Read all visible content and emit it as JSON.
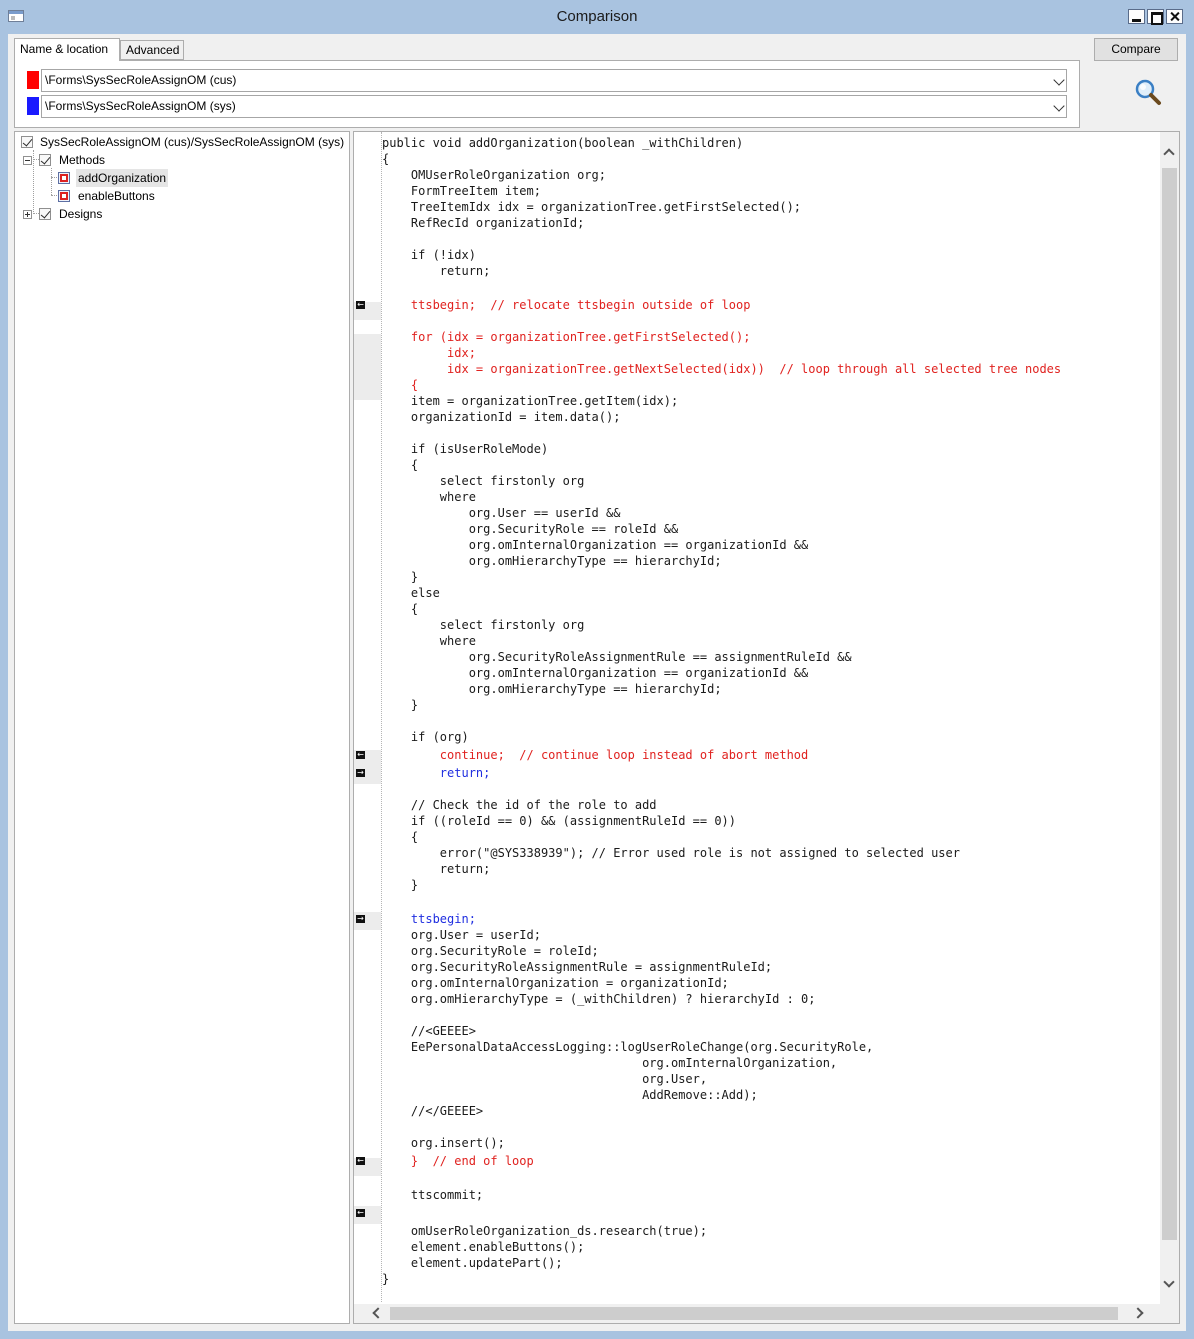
{
  "window": {
    "title": "Comparison"
  },
  "tabs": [
    {
      "label": "Name & location",
      "active": true
    },
    {
      "label": "Advanced",
      "active": false
    }
  ],
  "sources": [
    {
      "path": "\\Forms\\SysSecRoleAssignOM (cus)",
      "color": "#ff0000"
    },
    {
      "path": "\\Forms\\SysSecRoleAssignOM (sys)",
      "color": "#1a1aff"
    }
  ],
  "compare_button": {
    "label": "Compare"
  },
  "tree": {
    "root": "SysSecRoleAssignOM (cus)/SysSecRoleAssignOM (sys)",
    "methods_label": "Methods",
    "methods": [
      "addOrganization",
      "enableButtons"
    ],
    "designs_label": "Designs"
  },
  "code": {
    "lines": [
      {
        "text": "public void addOrganization(boolean _withChildren)",
        "style": "normal",
        "marker": "none"
      },
      {
        "text": "{",
        "style": "normal",
        "marker": "none"
      },
      {
        "text": "    OMUserRoleOrganization org;",
        "style": "normal",
        "marker": "none"
      },
      {
        "text": "    FormTreeItem item;",
        "style": "normal",
        "marker": "none"
      },
      {
        "text": "    TreeItemIdx idx = organizationTree.getFirstSelected();",
        "style": "normal",
        "marker": "none"
      },
      {
        "text": "    RefRecId organizationId;",
        "style": "normal",
        "marker": "none"
      },
      {
        "text": "",
        "style": "normal",
        "marker": "none"
      },
      {
        "text": "    if (!idx)",
        "style": "normal",
        "marker": "none"
      },
      {
        "text": "        return;",
        "style": "normal",
        "marker": "none"
      },
      {
        "text": "",
        "style": "normal",
        "marker": "none"
      },
      {
        "text": "    ttsbegin;  // relocate ttsbegin outside of loop",
        "style": "red",
        "marker": "left"
      },
      {
        "text": "",
        "style": "normal",
        "marker": "none"
      },
      {
        "text": "    for (idx = organizationTree.getFirstSelected();",
        "style": "red",
        "marker": "none"
      },
      {
        "text": "         idx;",
        "style": "red",
        "marker": "none"
      },
      {
        "text": "         idx = organizationTree.getNextSelected(idx))  // loop through all selected tree nodes",
        "style": "red",
        "marker": "none"
      },
      {
        "text": "    {",
        "style": "red",
        "marker": "none"
      },
      {
        "text": "    item = organizationTree.getItem(idx);",
        "style": "normal",
        "marker": "none"
      },
      {
        "text": "    organizationId = item.data();",
        "style": "normal",
        "marker": "none"
      },
      {
        "text": "",
        "style": "normal",
        "marker": "none"
      },
      {
        "text": "    if (isUserRoleMode)",
        "style": "normal",
        "marker": "none"
      },
      {
        "text": "    {",
        "style": "normal",
        "marker": "none"
      },
      {
        "text": "        select firstonly org",
        "style": "normal",
        "marker": "none"
      },
      {
        "text": "        where",
        "style": "normal",
        "marker": "none"
      },
      {
        "text": "            org.User == userId &&",
        "style": "normal",
        "marker": "none"
      },
      {
        "text": "            org.SecurityRole == roleId &&",
        "style": "normal",
        "marker": "none"
      },
      {
        "text": "            org.omInternalOrganization == organizationId &&",
        "style": "normal",
        "marker": "none"
      },
      {
        "text": "            org.omHierarchyType == hierarchyId;",
        "style": "normal",
        "marker": "none"
      },
      {
        "text": "    }",
        "style": "normal",
        "marker": "none"
      },
      {
        "text": "    else",
        "style": "normal",
        "marker": "none"
      },
      {
        "text": "    {",
        "style": "normal",
        "marker": "none"
      },
      {
        "text": "        select firstonly org",
        "style": "normal",
        "marker": "none"
      },
      {
        "text": "        where",
        "style": "normal",
        "marker": "none"
      },
      {
        "text": "            org.SecurityRoleAssignmentRule == assignmentRuleId &&",
        "style": "normal",
        "marker": "none"
      },
      {
        "text": "            org.omInternalOrganization == organizationId &&",
        "style": "normal",
        "marker": "none"
      },
      {
        "text": "            org.omHierarchyType == hierarchyId;",
        "style": "normal",
        "marker": "none"
      },
      {
        "text": "    }",
        "style": "normal",
        "marker": "none"
      },
      {
        "text": "",
        "style": "normal",
        "marker": "none"
      },
      {
        "text": "    if (org)",
        "style": "normal",
        "marker": "none"
      },
      {
        "text": "        continue;  // continue loop instead of abort method",
        "style": "red",
        "marker": "left"
      },
      {
        "text": "        return;",
        "style": "blue",
        "marker": "right"
      },
      {
        "text": "",
        "style": "normal",
        "marker": "none"
      },
      {
        "text": "    // Check the id of the role to add",
        "style": "normal",
        "marker": "none"
      },
      {
        "text": "    if ((roleId == 0) && (assignmentRuleId == 0))",
        "style": "normal",
        "marker": "none"
      },
      {
        "text": "    {",
        "style": "normal",
        "marker": "none"
      },
      {
        "text": "        error(\"@SYS338939\"); // Error used role is not assigned to selected user",
        "style": "normal",
        "marker": "none"
      },
      {
        "text": "        return;",
        "style": "normal",
        "marker": "none"
      },
      {
        "text": "    }",
        "style": "normal",
        "marker": "none"
      },
      {
        "text": "",
        "style": "normal",
        "marker": "none"
      },
      {
        "text": "    ttsbegin;",
        "style": "blue",
        "marker": "right"
      },
      {
        "text": "    org.User = userId;",
        "style": "normal",
        "marker": "none"
      },
      {
        "text": "    org.SecurityRole = roleId;",
        "style": "normal",
        "marker": "none"
      },
      {
        "text": "    org.SecurityRoleAssignmentRule = assignmentRuleId;",
        "style": "normal",
        "marker": "none"
      },
      {
        "text": "    org.omInternalOrganization = organizationId;",
        "style": "normal",
        "marker": "none"
      },
      {
        "text": "    org.omHierarchyType = (_withChildren) ? hierarchyId : 0;",
        "style": "normal",
        "marker": "none"
      },
      {
        "text": "",
        "style": "normal",
        "marker": "none"
      },
      {
        "text": "    //<GEEEE>",
        "style": "normal",
        "marker": "none"
      },
      {
        "text": "    EePersonalDataAccessLogging::logUserRoleChange(org.SecurityRole,",
        "style": "normal",
        "marker": "none"
      },
      {
        "text": "                                    org.omInternalOrganization,",
        "style": "normal",
        "marker": "none"
      },
      {
        "text": "                                    org.User,",
        "style": "normal",
        "marker": "none"
      },
      {
        "text": "                                    AddRemove::Add);",
        "style": "normal",
        "marker": "none"
      },
      {
        "text": "    //</GEEEE>",
        "style": "normal",
        "marker": "none"
      },
      {
        "text": "",
        "style": "normal",
        "marker": "none"
      },
      {
        "text": "    org.insert();",
        "style": "normal",
        "marker": "none"
      },
      {
        "text": "    }  // end of loop",
        "style": "red",
        "marker": "left"
      },
      {
        "text": "",
        "style": "normal",
        "marker": "none"
      },
      {
        "text": "    ttscommit;",
        "style": "normal",
        "marker": "none"
      },
      {
        "text": "",
        "style": "normal",
        "marker": "left"
      },
      {
        "text": "    omUserRoleOrganization_ds.research(true);",
        "style": "normal",
        "marker": "none"
      },
      {
        "text": "    element.enableButtons();",
        "style": "normal",
        "marker": "none"
      },
      {
        "text": "    element.updatePart();",
        "style": "normal",
        "marker": "none"
      },
      {
        "text": "}",
        "style": "normal",
        "marker": "none"
      }
    ]
  }
}
